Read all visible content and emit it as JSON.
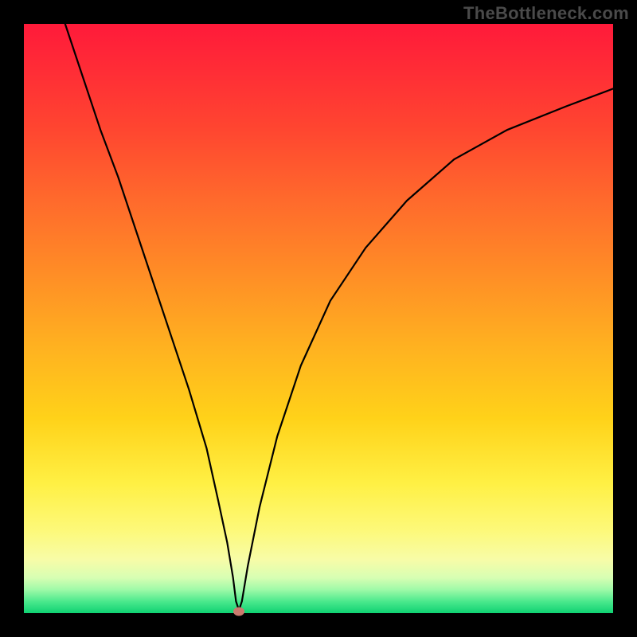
{
  "watermark": "TheBottleneck.com",
  "chart_data": {
    "type": "line",
    "title": "",
    "xlabel": "",
    "ylabel": "",
    "xlim": [
      0,
      100
    ],
    "ylim": [
      0,
      100
    ],
    "x": [
      7,
      10,
      13,
      16,
      19,
      22,
      25,
      28,
      31,
      33,
      34.5,
      35.5,
      36,
      36.5,
      37,
      38,
      40,
      43,
      47,
      52,
      58,
      65,
      73,
      82,
      92,
      100
    ],
    "y": [
      100,
      91,
      82,
      74,
      65,
      56,
      47,
      38,
      28,
      19,
      12,
      6,
      2,
      0.5,
      2,
      8,
      18,
      30,
      42,
      53,
      62,
      70,
      77,
      82,
      86,
      89
    ],
    "marker": {
      "x": 36.5,
      "y": 0.3
    },
    "annotations": []
  },
  "colors": {
    "curve": "#000000",
    "marker": "#cc7a6e",
    "frame": "#000000"
  }
}
